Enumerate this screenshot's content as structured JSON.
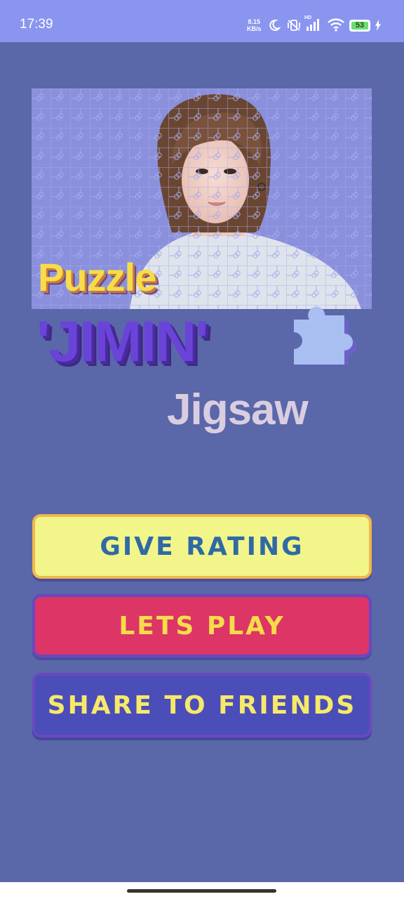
{
  "status_bar": {
    "time": "17:39",
    "net_speed_value": "8.15",
    "net_speed_unit": "KB/s",
    "battery_level": "53",
    "hd_label": "HD"
  },
  "title": {
    "line1": "Puzzle",
    "line2": "'JIMIN'",
    "line3": "Jigsaw"
  },
  "buttons": {
    "rating": "GIVE RATING",
    "play": "LETS PLAY",
    "share": "SHARE TO FRIENDS"
  },
  "colors": {
    "background": "#5a67a8",
    "status_bar": "#8a95f0",
    "rating_button": "#f2f58a",
    "play_button": "#dc3566",
    "share_button": "#4b4db8"
  }
}
